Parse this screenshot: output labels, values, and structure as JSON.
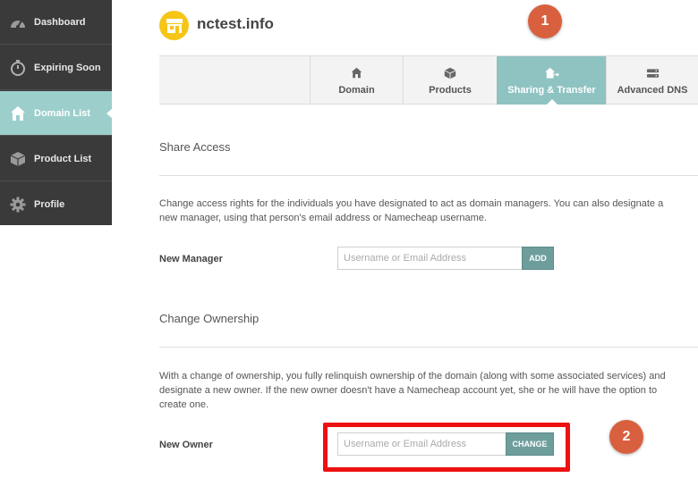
{
  "sidebar": {
    "items": [
      {
        "label": "Dashboard",
        "icon": "gauge-icon"
      },
      {
        "label": "Expiring Soon",
        "icon": "stopwatch-icon"
      },
      {
        "label": "Domain List",
        "icon": "home-icon",
        "active": true
      },
      {
        "label": "Product List",
        "icon": "box-icon"
      },
      {
        "label": "Profile",
        "icon": "gear-icon"
      }
    ]
  },
  "header": {
    "domain": "nctest.info",
    "logo_icon": "storefront-icon"
  },
  "tabs": [
    {
      "label": "Domain",
      "icon": "home-icon"
    },
    {
      "label": "Products",
      "icon": "box-icon"
    },
    {
      "label": "Sharing & Transfer",
      "icon": "share-home-icon",
      "active": true
    },
    {
      "label": "Advanced DNS",
      "icon": "server-icon"
    }
  ],
  "share_access": {
    "title": "Share Access",
    "description": "Change access rights for the individuals you have designated to act as domain managers. You can also designate a new manager, using that person's email address or Namecheap username.",
    "label": "New Manager",
    "placeholder": "Username or Email Address",
    "button": "ADD"
  },
  "change_ownership": {
    "title": "Change Ownership",
    "description": "With a change of ownership, you fully relinquish ownership of the domain (along with some associated services) and designate a new owner. If the new owner doesn't have a Namecheap account yet, she or he will have the option to create one.",
    "label": "New Owner",
    "placeholder": "Username or Email Address",
    "button": "CHANGE"
  },
  "callouts": [
    "1",
    "2"
  ],
  "colors": {
    "sidebar_bg": "#3a3a3a",
    "active_teal": "#9ccfcc",
    "tab_active": "#8fc3c1",
    "button": "#6e9e9c",
    "badge": "#d9603e",
    "highlight": "#ee1111",
    "logo": "#f5c518"
  }
}
